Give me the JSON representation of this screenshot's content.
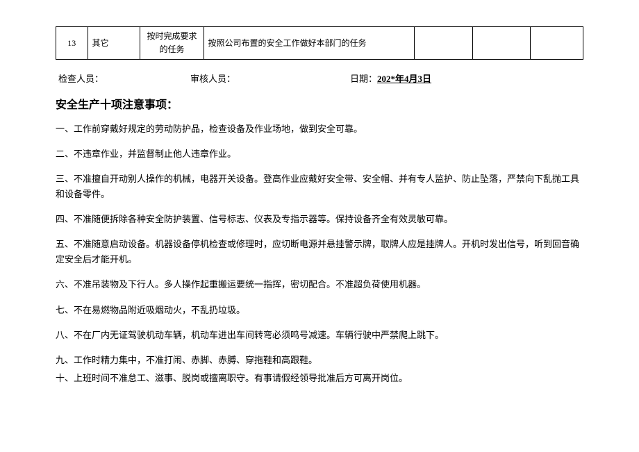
{
  "table": {
    "row_index": "13",
    "category": "其它",
    "requirement": "按时完成要求的任务",
    "description": "按照公司布置的安全工作做好本部门的任务"
  },
  "signature": {
    "inspector_label": "检查人员：",
    "reviewer_label": "审核人员：",
    "date_label": "日期：",
    "date_value": "202*年4月3日"
  },
  "section_title": "安全生产十项注意事项：",
  "notices": {
    "n1": "一、工作前穿戴好规定的劳动防护品，检查设备及作业场地，做到安全可靠。",
    "n2": "二、不违章作业，并监督制止他人违章作业。",
    "n3": "三、不准擅自开动别人操作的机械，电器开关设备。登高作业应戴好安全带、安全帽、并有专人监护、防止坠落，严禁向下乱抛工具和设备零件。",
    "n4": "四、不准随便拆除各种安全防护装置、信号标志、仪表及专指示器等。保持设备齐全有效灵敏可靠。",
    "n5": "五、不准随意启动设备。机器设备停机检查或修理时，应切断电源并悬挂警示牌，取牌人应是挂牌人。开机时发出信号，听到回音确定安全后才能开机。",
    "n6": "六、不准吊装物及下行人。多人操作起重搬运要统一指挥，密切配合。不准超负荷使用机器。",
    "n7": "七、不在易燃物品附近吸烟动火，不乱扔垃圾。",
    "n8": "八、不在厂内无证驾驶机动车辆，机动车进出车间转弯必须鸣号减速。车辆行驶中严禁爬上跳下。",
    "n9": "九、工作时精力集中，不准打闹、赤脚、赤膊、穿拖鞋和高跟鞋。",
    "n10": "十、上班时间不准怠工、滋事、脱岗或擅离职守。有事请假经领导批准后方可离开岗位。"
  }
}
